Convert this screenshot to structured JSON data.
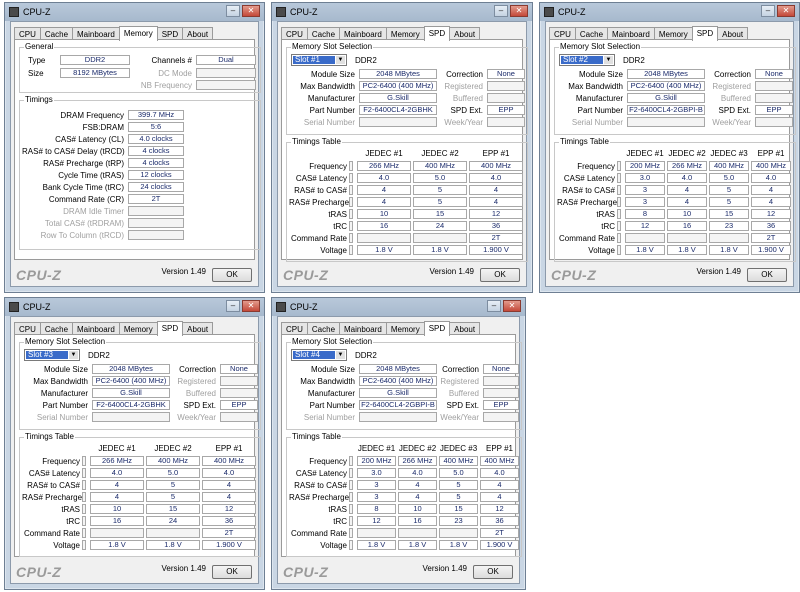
{
  "app": {
    "title": "CPU-Z",
    "logo": "CPU-Z",
    "version": "Version 1.49",
    "ok_label": "OK"
  },
  "tabs": [
    "CPU",
    "Cache",
    "Mainboard",
    "Memory",
    "SPD",
    "About"
  ],
  "memory": {
    "general_title": "General",
    "type_label": "Type",
    "type": "DDR2",
    "size_label": "Size",
    "size": "8192 MBytes",
    "channels_label": "Channels #",
    "channels": "Dual",
    "dcmode_label": "DC Mode",
    "nbfreq_label": "NB Frequency",
    "timings_title": "Timings",
    "rows": [
      {
        "label": "DRAM Frequency",
        "value": "399.7 MHz",
        "gray": false
      },
      {
        "label": "FSB:DRAM",
        "value": "5:6",
        "gray": false
      },
      {
        "label": "CAS# Latency (CL)",
        "value": "4.0 clocks",
        "gray": false
      },
      {
        "label": "RAS# to CAS# Delay (tRCD)",
        "value": "4 clocks",
        "gray": false
      },
      {
        "label": "RAS# Precharge (tRP)",
        "value": "4 clocks",
        "gray": false
      },
      {
        "label": "Cycle Time (tRAS)",
        "value": "12 clocks",
        "gray": false
      },
      {
        "label": "Bank Cycle Time (tRC)",
        "value": "24 clocks",
        "gray": false
      },
      {
        "label": "Command Rate (CR)",
        "value": "2T",
        "gray": false
      },
      {
        "label": "DRAM Idle Timer",
        "value": "",
        "gray": true
      },
      {
        "label": "Total CAS# (tRDRAM)",
        "value": "",
        "gray": true
      },
      {
        "label": "Row To Column (tRCD)",
        "value": "",
        "gray": true
      }
    ]
  },
  "spd_labels": {
    "slot_group": "Memory Slot Selection",
    "module_size": "Module Size",
    "max_bandwidth": "Max Bandwidth",
    "manufacturer": "Manufacturer",
    "part_number": "Part Number",
    "serial_number": "Serial Number",
    "correction": "Correction",
    "registered": "Registered",
    "buffered": "Buffered",
    "spd_ext": "SPD Ext.",
    "week_year": "Week/Year",
    "timings_group": "Timings Table",
    "row_labels": [
      "Frequency",
      "CAS# Latency",
      "RAS# to CAS#",
      "RAS# Precharge",
      "tRAS",
      "tRC",
      "Command Rate",
      "Voltage"
    ]
  },
  "spd_slots": [
    {
      "slot": "Slot #1",
      "type": "DDR2",
      "module_size": "2048 MBytes",
      "max_bandwidth": "PC2-6400 (400 MHz)",
      "manufacturer": "G.Skill",
      "part_number": "F2-6400CL4-2GBHK",
      "correction": "None",
      "spd_ext": "EPP",
      "columns": [
        "JEDEC #1",
        "JEDEC #2",
        "EPP #1"
      ],
      "rows": [
        [
          "266 MHz",
          "400 MHz",
          "400 MHz"
        ],
        [
          "4.0",
          "5.0",
          "4.0"
        ],
        [
          "4",
          "5",
          "4"
        ],
        [
          "4",
          "5",
          "4"
        ],
        [
          "10",
          "15",
          "12"
        ],
        [
          "16",
          "24",
          "36"
        ],
        [
          "",
          "",
          "2T"
        ],
        [
          "1.8 V",
          "1.8 V",
          "1.900 V"
        ]
      ]
    },
    {
      "slot": "Slot #2",
      "type": "DDR2",
      "module_size": "2048 MBytes",
      "max_bandwidth": "PC2-6400 (400 MHz)",
      "manufacturer": "G.Skill",
      "part_number": "F2-6400CL4-2GBPI-B",
      "correction": "None",
      "spd_ext": "EPP",
      "columns": [
        "JEDEC #1",
        "JEDEC #2",
        "JEDEC #3",
        "EPP #1"
      ],
      "rows": [
        [
          "200 MHz",
          "266 MHz",
          "400 MHz",
          "400 MHz"
        ],
        [
          "3.0",
          "4.0",
          "5.0",
          "4.0"
        ],
        [
          "3",
          "4",
          "5",
          "4"
        ],
        [
          "3",
          "4",
          "5",
          "4"
        ],
        [
          "8",
          "10",
          "15",
          "12"
        ],
        [
          "12",
          "16",
          "23",
          "36"
        ],
        [
          "",
          "",
          "",
          "2T"
        ],
        [
          "1.8 V",
          "1.8 V",
          "1.8 V",
          "1.900 V"
        ]
      ]
    },
    {
      "slot": "Slot #3",
      "type": "DDR2",
      "module_size": "2048 MBytes",
      "max_bandwidth": "PC2-6400 (400 MHz)",
      "manufacturer": "G.Skill",
      "part_number": "F2-6400CL4-2GBHK",
      "correction": "None",
      "spd_ext": "EPP",
      "columns": [
        "JEDEC #1",
        "JEDEC #2",
        "EPP #1"
      ],
      "rows": [
        [
          "266 MHz",
          "400 MHz",
          "400 MHz"
        ],
        [
          "4.0",
          "5.0",
          "4.0"
        ],
        [
          "4",
          "5",
          "4"
        ],
        [
          "4",
          "5",
          "4"
        ],
        [
          "10",
          "15",
          "12"
        ],
        [
          "16",
          "24",
          "36"
        ],
        [
          "",
          "",
          "2T"
        ],
        [
          "1.8 V",
          "1.8 V",
          "1.900 V"
        ]
      ]
    },
    {
      "slot": "Slot #4",
      "type": "DDR2",
      "module_size": "2048 MBytes",
      "max_bandwidth": "PC2-6400 (400 MHz)",
      "manufacturer": "G.Skill",
      "part_number": "F2-6400CL4-2GBPI-B",
      "correction": "None",
      "spd_ext": "EPP",
      "columns": [
        "JEDEC #1",
        "JEDEC #2",
        "JEDEC #3",
        "EPP #1"
      ],
      "rows": [
        [
          "200 MHz",
          "266 MHz",
          "400 MHz",
          "400 MHz"
        ],
        [
          "3.0",
          "4.0",
          "5.0",
          "4.0"
        ],
        [
          "3",
          "4",
          "5",
          "4"
        ],
        [
          "3",
          "4",
          "5",
          "4"
        ],
        [
          "8",
          "10",
          "15",
          "12"
        ],
        [
          "12",
          "16",
          "23",
          "36"
        ],
        [
          "",
          "",
          "",
          "2T"
        ],
        [
          "1.8 V",
          "1.8 V",
          "1.8 V",
          "1.900 V"
        ]
      ]
    }
  ]
}
